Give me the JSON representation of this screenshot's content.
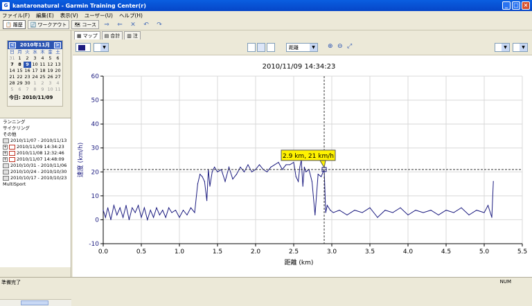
{
  "window": {
    "title": "kantaronatural - Garmin Training Center(r)"
  },
  "menu": [
    "ファイル(F)",
    "編集(E)",
    "表示(V)",
    "ユーザー(U)",
    "ヘルプ(H)"
  ],
  "toolbar": {
    "history": "履歴",
    "workout": "ワークアウト",
    "course": "コース"
  },
  "calendar": {
    "month_label": "2010年11月",
    "weekdays": [
      "日",
      "月",
      "火",
      "水",
      "木",
      "金",
      "土"
    ],
    "days": [
      {
        "d": "31",
        "c": "dim"
      },
      {
        "d": "1",
        "c": ""
      },
      {
        "d": "2",
        "c": ""
      },
      {
        "d": "3",
        "c": ""
      },
      {
        "d": "4",
        "c": ""
      },
      {
        "d": "5",
        "c": ""
      },
      {
        "d": "6",
        "c": ""
      },
      {
        "d": "7",
        "c": "bold"
      },
      {
        "d": "8",
        "c": "bold"
      },
      {
        "d": "9",
        "c": "sel"
      },
      {
        "d": "10",
        "c": ""
      },
      {
        "d": "11",
        "c": ""
      },
      {
        "d": "12",
        "c": ""
      },
      {
        "d": "13",
        "c": ""
      },
      {
        "d": "14",
        "c": ""
      },
      {
        "d": "15",
        "c": ""
      },
      {
        "d": "16",
        "c": ""
      },
      {
        "d": "17",
        "c": ""
      },
      {
        "d": "18",
        "c": ""
      },
      {
        "d": "19",
        "c": ""
      },
      {
        "d": "20",
        "c": ""
      },
      {
        "d": "21",
        "c": ""
      },
      {
        "d": "22",
        "c": ""
      },
      {
        "d": "23",
        "c": ""
      },
      {
        "d": "24",
        "c": ""
      },
      {
        "d": "25",
        "c": ""
      },
      {
        "d": "26",
        "c": ""
      },
      {
        "d": "27",
        "c": ""
      },
      {
        "d": "28",
        "c": ""
      },
      {
        "d": "29",
        "c": ""
      },
      {
        "d": "30",
        "c": ""
      },
      {
        "d": "1",
        "c": "dim"
      },
      {
        "d": "2",
        "c": "dim"
      },
      {
        "d": "3",
        "c": "dim"
      },
      {
        "d": "4",
        "c": "dim"
      },
      {
        "d": "5",
        "c": "dim"
      },
      {
        "d": "6",
        "c": "dim"
      },
      {
        "d": "7",
        "c": "dim"
      },
      {
        "d": "8",
        "c": "dim"
      },
      {
        "d": "9",
        "c": "dim"
      },
      {
        "d": "10",
        "c": "dim"
      },
      {
        "d": "11",
        "c": "dim"
      }
    ],
    "today_label": "今日: 2010/11/09"
  },
  "tree": {
    "categories": [
      "ランニング",
      "サイクリング",
      "その他"
    ],
    "items": [
      {
        "label": "2010/11/07 - 2010/11/13",
        "kind": "week"
      },
      {
        "label": "2010/11/09 14:34:23",
        "kind": "activity"
      },
      {
        "label": "2010/11/08 12:32:46",
        "kind": "activity"
      },
      {
        "label": "2010/11/07 14:48:09",
        "kind": "activity"
      },
      {
        "label": "2010/10/31 - 2010/11/06",
        "kind": "week"
      },
      {
        "label": "2010/10/24 - 2010/10/30",
        "kind": "week"
      },
      {
        "label": "2010/10/17 - 2010/10/23",
        "kind": "week"
      }
    ],
    "multisport": "MultiSport"
  },
  "tabs": {
    "map": "マップ",
    "summary": "合計",
    "notes": "注"
  },
  "chart_controls": {
    "xaxis_select": "距離"
  },
  "statusbar": {
    "left": "準備完了",
    "right": "NUM"
  },
  "colors": {
    "line": "#1c1c80",
    "tooltip": "#fff200",
    "grid": "#d8d8d8"
  },
  "chart_data": {
    "type": "line",
    "title": "2010/11/09 14:34:23",
    "xlabel": "距離 (km)",
    "ylabel": "速度 (km/h)",
    "xlim": [
      0.0,
      5.5
    ],
    "ylim": [
      -10,
      60
    ],
    "xticks": [
      "0.0",
      "0.5",
      "1.0",
      "1.5",
      "2.0",
      "2.5",
      "3.0",
      "3.5",
      "4.0",
      "4.5",
      "5.0",
      "5.5"
    ],
    "yticks": [
      "-10",
      "0",
      "10",
      "20",
      "30",
      "40",
      "50",
      "60"
    ],
    "x": [
      0.0,
      0.03,
      0.06,
      0.1,
      0.14,
      0.18,
      0.22,
      0.26,
      0.3,
      0.34,
      0.38,
      0.42,
      0.46,
      0.5,
      0.54,
      0.58,
      0.62,
      0.66,
      0.7,
      0.74,
      0.78,
      0.82,
      0.86,
      0.9,
      0.95,
      1.0,
      1.05,
      1.1,
      1.15,
      1.2,
      1.24,
      1.27,
      1.3,
      1.33,
      1.36,
      1.38,
      1.4,
      1.43,
      1.46,
      1.5,
      1.55,
      1.6,
      1.65,
      1.7,
      1.75,
      1.8,
      1.85,
      1.9,
      1.95,
      2.0,
      2.05,
      2.1,
      2.15,
      2.2,
      2.25,
      2.3,
      2.35,
      2.4,
      2.45,
      2.5,
      2.53,
      2.56,
      2.58,
      2.6,
      2.62,
      2.64,
      2.66,
      2.7,
      2.74,
      2.78,
      2.82,
      2.86,
      2.9,
      2.92,
      2.94,
      2.98,
      3.02,
      3.1,
      3.2,
      3.3,
      3.4,
      3.5,
      3.6,
      3.7,
      3.8,
      3.9,
      4.0,
      4.1,
      4.2,
      4.3,
      4.4,
      4.5,
      4.6,
      4.7,
      4.8,
      4.9,
      5.0,
      5.05,
      5.1,
      5.12
    ],
    "y": [
      4,
      1,
      5,
      0,
      6,
      2,
      5,
      1,
      6,
      0,
      5,
      3,
      6,
      1,
      5,
      0,
      4,
      1,
      5,
      2,
      4,
      1,
      5,
      3,
      4,
      1,
      4,
      2,
      5,
      3,
      15,
      19,
      18,
      16,
      8,
      21,
      14,
      20,
      22,
      20,
      21,
      16,
      22,
      17,
      19,
      22,
      20,
      23,
      20,
      21,
      23,
      21,
      20,
      22,
      23,
      24,
      21,
      23,
      23,
      24,
      18,
      16,
      22,
      25,
      14,
      22,
      20,
      21,
      16,
      2,
      19,
      18,
      21,
      3,
      6,
      4,
      3,
      4,
      2,
      4,
      3,
      5,
      1,
      4,
      3,
      5,
      2,
      4,
      3,
      4,
      2,
      4,
      3,
      5,
      2,
      4,
      3,
      6,
      1,
      16
    ],
    "marker": {
      "x": 2.9,
      "y": 21,
      "label": "2.9 km, 21 km/h"
    }
  }
}
